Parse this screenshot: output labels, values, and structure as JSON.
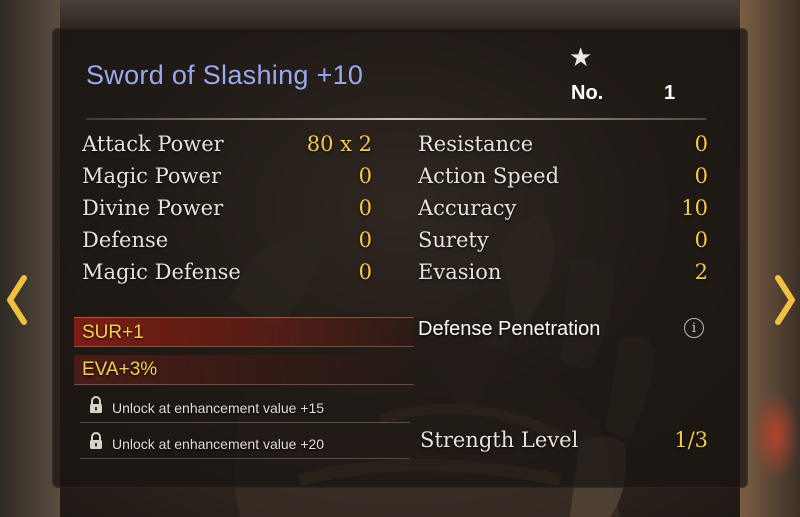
{
  "item": {
    "name": "Sword of Slashing +10",
    "number_label": "No.",
    "number_value": "1"
  },
  "stats_left": [
    {
      "label": "Attack Power",
      "value": "80 x 2"
    },
    {
      "label": "Magic Power",
      "value": "0"
    },
    {
      "label": "Divine Power",
      "value": "0"
    },
    {
      "label": "Defense",
      "value": "0"
    },
    {
      "label": "Magic Defense",
      "value": "0"
    }
  ],
  "stats_right": [
    {
      "label": "Resistance",
      "value": "0"
    },
    {
      "label": "Action Speed",
      "value": "0"
    },
    {
      "label": "Accuracy",
      "value": "10"
    },
    {
      "label": "Surety",
      "value": "0"
    },
    {
      "label": "Evasion",
      "value": "2"
    }
  ],
  "bonuses": [
    "SUR+1",
    "EVA+3%"
  ],
  "locked_slots": [
    "Unlock at enhancement value +15",
    "Unlock at enhancement value +20"
  ],
  "special": {
    "label": "Defense Penetration",
    "info_glyph": "i"
  },
  "strength": {
    "label": "Strength Level",
    "value": "1/3"
  },
  "icons": {
    "star": "star-icon",
    "lock": "lock-icon",
    "info": "info-icon",
    "arrow_left": "chevron-left-icon",
    "arrow_right": "chevron-right-icon"
  },
  "colors": {
    "title": "#9aa8f0",
    "value": "#f5c94a",
    "bonus_text": "#f2d24a",
    "arrow": "#f0c040"
  }
}
